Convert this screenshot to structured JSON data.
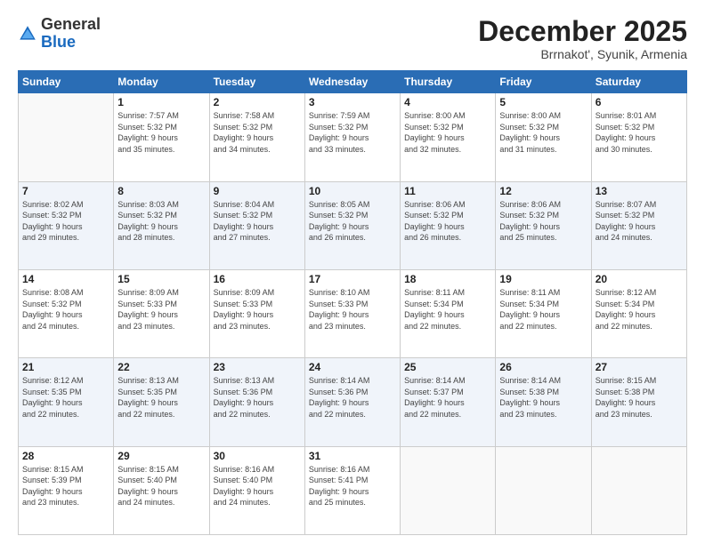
{
  "header": {
    "logo": {
      "general": "General",
      "blue": "Blue"
    },
    "title": "December 2025",
    "subtitle": "Brrnakot', Syunik, Armenia"
  },
  "days_of_week": [
    "Sunday",
    "Monday",
    "Tuesday",
    "Wednesday",
    "Thursday",
    "Friday",
    "Saturday"
  ],
  "weeks": [
    [
      {
        "day": "",
        "sunrise": "",
        "sunset": "",
        "daylight": ""
      },
      {
        "day": "1",
        "sunrise": "Sunrise: 7:57 AM",
        "sunset": "Sunset: 5:32 PM",
        "daylight": "Daylight: 9 hours and 35 minutes."
      },
      {
        "day": "2",
        "sunrise": "Sunrise: 7:58 AM",
        "sunset": "Sunset: 5:32 PM",
        "daylight": "Daylight: 9 hours and 34 minutes."
      },
      {
        "day": "3",
        "sunrise": "Sunrise: 7:59 AM",
        "sunset": "Sunset: 5:32 PM",
        "daylight": "Daylight: 9 hours and 33 minutes."
      },
      {
        "day": "4",
        "sunrise": "Sunrise: 8:00 AM",
        "sunset": "Sunset: 5:32 PM",
        "daylight": "Daylight: 9 hours and 32 minutes."
      },
      {
        "day": "5",
        "sunrise": "Sunrise: 8:00 AM",
        "sunset": "Sunset: 5:32 PM",
        "daylight": "Daylight: 9 hours and 31 minutes."
      },
      {
        "day": "6",
        "sunrise": "Sunrise: 8:01 AM",
        "sunset": "Sunset: 5:32 PM",
        "daylight": "Daylight: 9 hours and 30 minutes."
      }
    ],
    [
      {
        "day": "7",
        "sunrise": "Sunrise: 8:02 AM",
        "sunset": "Sunset: 5:32 PM",
        "daylight": "Daylight: 9 hours and 29 minutes."
      },
      {
        "day": "8",
        "sunrise": "Sunrise: 8:03 AM",
        "sunset": "Sunset: 5:32 PM",
        "daylight": "Daylight: 9 hours and 28 minutes."
      },
      {
        "day": "9",
        "sunrise": "Sunrise: 8:04 AM",
        "sunset": "Sunset: 5:32 PM",
        "daylight": "Daylight: 9 hours and 27 minutes."
      },
      {
        "day": "10",
        "sunrise": "Sunrise: 8:05 AM",
        "sunset": "Sunset: 5:32 PM",
        "daylight": "Daylight: 9 hours and 26 minutes."
      },
      {
        "day": "11",
        "sunrise": "Sunrise: 8:06 AM",
        "sunset": "Sunset: 5:32 PM",
        "daylight": "Daylight: 9 hours and 26 minutes."
      },
      {
        "day": "12",
        "sunrise": "Sunrise: 8:06 AM",
        "sunset": "Sunset: 5:32 PM",
        "daylight": "Daylight: 9 hours and 25 minutes."
      },
      {
        "day": "13",
        "sunrise": "Sunrise: 8:07 AM",
        "sunset": "Sunset: 5:32 PM",
        "daylight": "Daylight: 9 hours and 24 minutes."
      }
    ],
    [
      {
        "day": "14",
        "sunrise": "Sunrise: 8:08 AM",
        "sunset": "Sunset: 5:32 PM",
        "daylight": "Daylight: 9 hours and 24 minutes."
      },
      {
        "day": "15",
        "sunrise": "Sunrise: 8:09 AM",
        "sunset": "Sunset: 5:33 PM",
        "daylight": "Daylight: 9 hours and 23 minutes."
      },
      {
        "day": "16",
        "sunrise": "Sunrise: 8:09 AM",
        "sunset": "Sunset: 5:33 PM",
        "daylight": "Daylight: 9 hours and 23 minutes."
      },
      {
        "day": "17",
        "sunrise": "Sunrise: 8:10 AM",
        "sunset": "Sunset: 5:33 PM",
        "daylight": "Daylight: 9 hours and 23 minutes."
      },
      {
        "day": "18",
        "sunrise": "Sunrise: 8:11 AM",
        "sunset": "Sunset: 5:34 PM",
        "daylight": "Daylight: 9 hours and 22 minutes."
      },
      {
        "day": "19",
        "sunrise": "Sunrise: 8:11 AM",
        "sunset": "Sunset: 5:34 PM",
        "daylight": "Daylight: 9 hours and 22 minutes."
      },
      {
        "day": "20",
        "sunrise": "Sunrise: 8:12 AM",
        "sunset": "Sunset: 5:34 PM",
        "daylight": "Daylight: 9 hours and 22 minutes."
      }
    ],
    [
      {
        "day": "21",
        "sunrise": "Sunrise: 8:12 AM",
        "sunset": "Sunset: 5:35 PM",
        "daylight": "Daylight: 9 hours and 22 minutes."
      },
      {
        "day": "22",
        "sunrise": "Sunrise: 8:13 AM",
        "sunset": "Sunset: 5:35 PM",
        "daylight": "Daylight: 9 hours and 22 minutes."
      },
      {
        "day": "23",
        "sunrise": "Sunrise: 8:13 AM",
        "sunset": "Sunset: 5:36 PM",
        "daylight": "Daylight: 9 hours and 22 minutes."
      },
      {
        "day": "24",
        "sunrise": "Sunrise: 8:14 AM",
        "sunset": "Sunset: 5:36 PM",
        "daylight": "Daylight: 9 hours and 22 minutes."
      },
      {
        "day": "25",
        "sunrise": "Sunrise: 8:14 AM",
        "sunset": "Sunset: 5:37 PM",
        "daylight": "Daylight: 9 hours and 22 minutes."
      },
      {
        "day": "26",
        "sunrise": "Sunrise: 8:14 AM",
        "sunset": "Sunset: 5:38 PM",
        "daylight": "Daylight: 9 hours and 23 minutes."
      },
      {
        "day": "27",
        "sunrise": "Sunrise: 8:15 AM",
        "sunset": "Sunset: 5:38 PM",
        "daylight": "Daylight: 9 hours and 23 minutes."
      }
    ],
    [
      {
        "day": "28",
        "sunrise": "Sunrise: 8:15 AM",
        "sunset": "Sunset: 5:39 PM",
        "daylight": "Daylight: 9 hours and 23 minutes."
      },
      {
        "day": "29",
        "sunrise": "Sunrise: 8:15 AM",
        "sunset": "Sunset: 5:40 PM",
        "daylight": "Daylight: 9 hours and 24 minutes."
      },
      {
        "day": "30",
        "sunrise": "Sunrise: 8:16 AM",
        "sunset": "Sunset: 5:40 PM",
        "daylight": "Daylight: 9 hours and 24 minutes."
      },
      {
        "day": "31",
        "sunrise": "Sunrise: 8:16 AM",
        "sunset": "Sunset: 5:41 PM",
        "daylight": "Daylight: 9 hours and 25 minutes."
      },
      {
        "day": "",
        "sunrise": "",
        "sunset": "",
        "daylight": ""
      },
      {
        "day": "",
        "sunrise": "",
        "sunset": "",
        "daylight": ""
      },
      {
        "day": "",
        "sunrise": "",
        "sunset": "",
        "daylight": ""
      }
    ]
  ]
}
